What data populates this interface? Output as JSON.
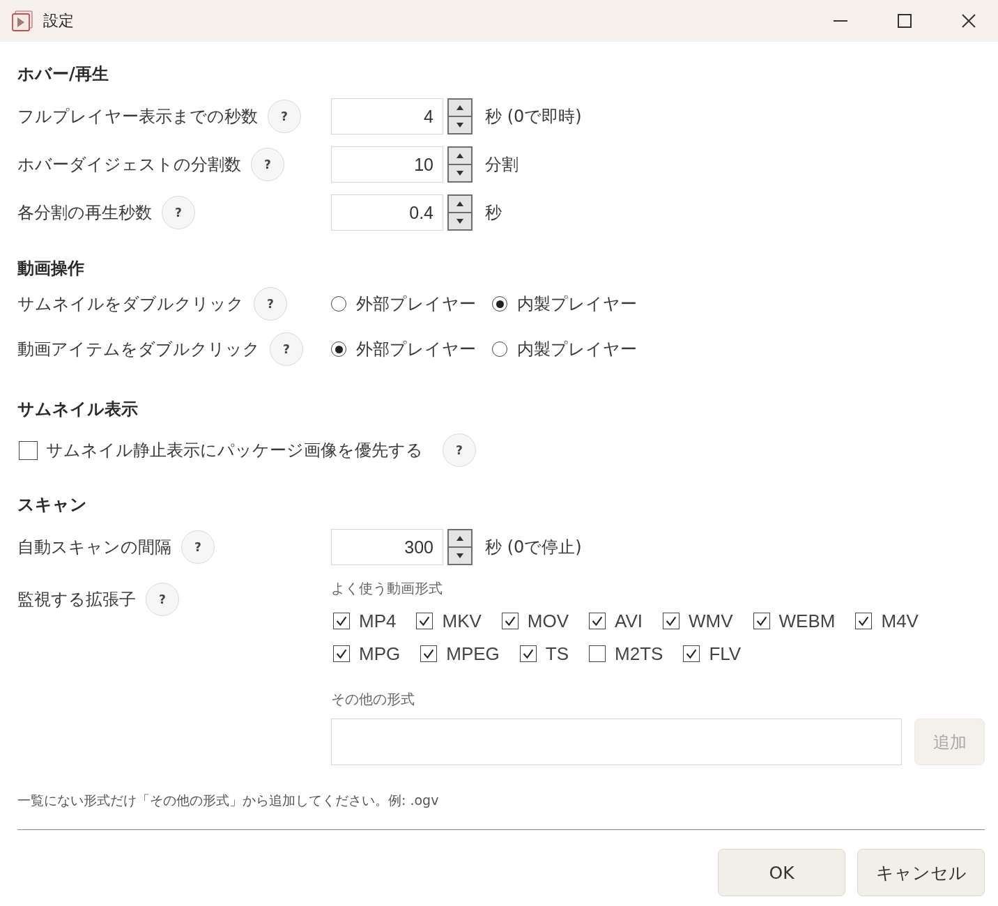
{
  "window": {
    "title": "設定"
  },
  "sections": [
    {
      "heading": "ホバー/再生",
      "rows": [
        {
          "kind": "spinner",
          "label": "フルプレイヤー表示までの秒数",
          "help": "?",
          "value": "4",
          "unit": "秒 (0で即時)"
        },
        {
          "kind": "spinner",
          "label": "ホバーダイジェストの分割数",
          "help": "?",
          "value": "10",
          "unit": "分割"
        },
        {
          "kind": "spinner",
          "label": "各分割の再生秒数",
          "help": "?",
          "value": "0.4",
          "unit": "秒"
        }
      ]
    },
    {
      "heading": "動画操作",
      "rows": [
        {
          "kind": "radio",
          "label": "サムネイルをダブルクリック",
          "help": "?",
          "options": [
            {
              "label": "外部プレイヤー",
              "selected": false
            },
            {
              "label": "内製プレイヤー",
              "selected": true
            }
          ]
        },
        {
          "kind": "radio",
          "label": "動画アイテムをダブルクリック",
          "help": "?",
          "options": [
            {
              "label": "外部プレイヤー",
              "selected": true
            },
            {
              "label": "内製プレイヤー",
              "selected": false
            }
          ]
        }
      ]
    },
    {
      "heading": "サムネイル表示",
      "rows": [
        {
          "kind": "checkbox",
          "label": "サムネイル静止表示にパッケージ画像を優先する",
          "checked": false,
          "help": "?"
        }
      ]
    },
    {
      "heading": "スキャン",
      "rows": [
        {
          "kind": "spinner",
          "label": "自動スキャンの間隔",
          "help": "?",
          "value": "300",
          "unit": "秒 (0で停止)"
        },
        {
          "kind": "extensions",
          "label": "監視する拡張子",
          "help": "?",
          "common_label": "よく使う動画形式",
          "format_rows": [
            [
              {
                "label": "MP4",
                "checked": true
              },
              {
                "label": "MKV",
                "checked": true
              },
              {
                "label": "MOV",
                "checked": true
              },
              {
                "label": "AVI",
                "checked": true
              },
              {
                "label": "WMV",
                "checked": true
              },
              {
                "label": "WEBM",
                "checked": true
              },
              {
                "label": "M4V",
                "checked": true
              }
            ],
            [
              {
                "label": "MPG",
                "checked": true
              },
              {
                "label": "MPEG",
                "checked": true
              },
              {
                "label": "TS",
                "checked": true
              },
              {
                "label": "M2TS",
                "checked": false
              },
              {
                "label": "FLV",
                "checked": true
              }
            ]
          ],
          "other_label": "その他の形式",
          "add_button": {
            "label": "追加",
            "disabled": true
          }
        }
      ]
    }
  ],
  "hint": "一覧にない形式だけ「その他の形式」から追加してください。例: .ogv",
  "buttons": [
    {
      "label": "OK"
    },
    {
      "label": "キャンセル"
    }
  ]
}
